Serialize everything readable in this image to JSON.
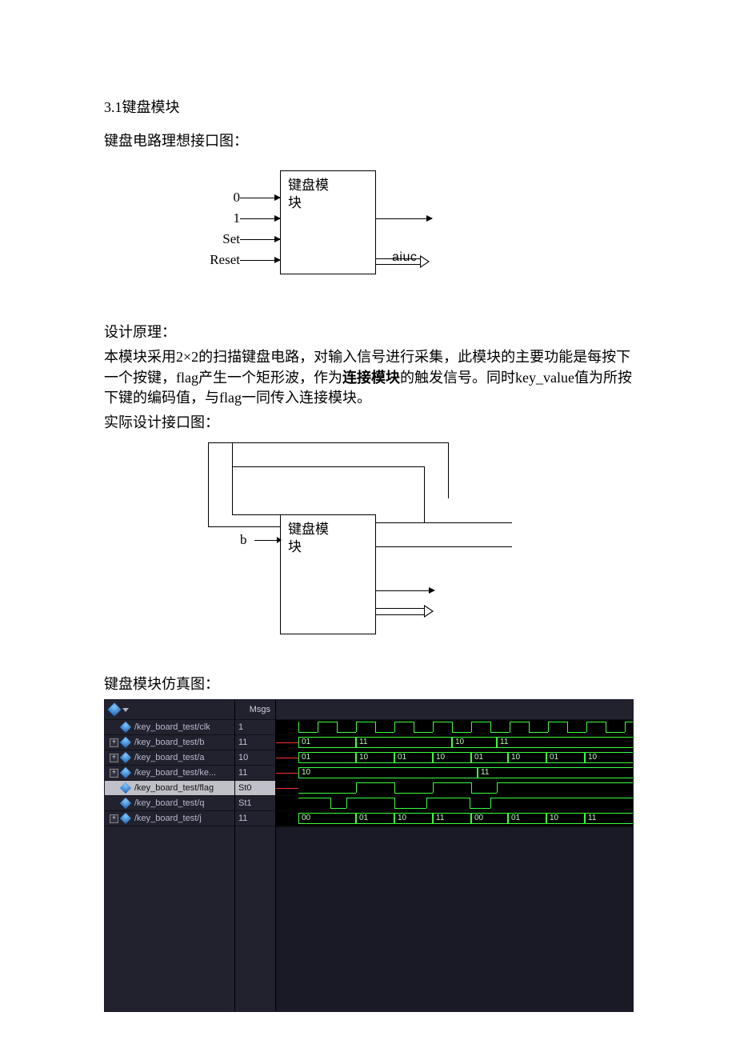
{
  "section_title": "3.1键盘模块",
  "para1": "键盘电路理想接口图：",
  "diagram1": {
    "block_label": "键盘模块",
    "inputs": [
      "0",
      "1",
      "Set",
      "Reset"
    ],
    "clipped_text": "aiuc"
  },
  "para2_title": "设计原理：",
  "para2_body": "本模块采用2×2的扫描键盘电路，对输入信号进行采集，此模块的主要功能是每按下一个按键，flag产生一个矩形波，作为连接模块的触发信号。同时key_value值为所按下键的编码值，与flag一同传入连接模块。",
  "para3": "实际设计接口图：",
  "diagram2": {
    "block_label": "键盘模块",
    "left_label": "b"
  },
  "wave_caption": "键盘模块仿真图：",
  "waveform": {
    "msgs_label": "Msgs",
    "icon_name": "modelsim-logo-icon",
    "signals": [
      {
        "name": "/key_board_test/clk",
        "value": "1",
        "expandable": false
      },
      {
        "name": "/key_board_test/b",
        "value": "11",
        "expandable": true
      },
      {
        "name": "/key_board_test/a",
        "value": "10",
        "expandable": true
      },
      {
        "name": "/key_board_test/ke...",
        "value": "11",
        "expandable": true
      },
      {
        "name": "/key_board_test/flag",
        "value": "St0",
        "expandable": false,
        "selected": true
      },
      {
        "name": "/key_board_test/q",
        "value": "St1",
        "expandable": false
      },
      {
        "name": "/key_board_test/j",
        "value": "11",
        "expandable": true
      }
    ],
    "lanes": {
      "clk": {
        "type": "clock"
      },
      "b": {
        "segments": [
          [
            "01",
            0,
            72
          ],
          [
            "11",
            72,
            192
          ],
          [
            "10",
            192,
            248
          ],
          [
            "11",
            248,
            450
          ]
        ]
      },
      "a": {
        "segments": [
          [
            "01",
            0,
            72
          ],
          [
            "10",
            72,
            120
          ],
          [
            "01",
            120,
            168
          ],
          [
            "10",
            168,
            216
          ],
          [
            "01",
            216,
            262
          ],
          [
            "10",
            262,
            310
          ],
          [
            "01",
            310,
            358
          ],
          [
            "10",
            358,
            450
          ]
        ]
      },
      "ke": {
        "segments": [
          [
            "10",
            0,
            224
          ],
          [
            "11",
            224,
            450
          ]
        ]
      },
      "flag": {
        "type": "pulse",
        "edges": [
          [
            0,
            0
          ],
          [
            72,
            1
          ],
          [
            120,
            0
          ],
          [
            168,
            1
          ],
          [
            216,
            0
          ],
          [
            248,
            1
          ],
          [
            450,
            1
          ]
        ]
      },
      "q": {
        "type": "literal",
        "edges": [
          [
            0,
            1
          ],
          [
            40,
            1
          ],
          [
            40,
            0
          ],
          [
            60,
            0
          ],
          [
            60,
            1
          ],
          [
            120,
            1
          ],
          [
            120,
            0
          ],
          [
            160,
            0
          ],
          [
            160,
            1
          ],
          [
            214,
            1
          ],
          [
            214,
            0
          ],
          [
            240,
            0
          ],
          [
            240,
            1
          ],
          [
            450,
            1
          ]
        ]
      },
      "j": {
        "segments": [
          [
            "00",
            0,
            72
          ],
          [
            "01",
            72,
            120
          ],
          [
            "10",
            120,
            168
          ],
          [
            "11",
            168,
            216
          ],
          [
            "00",
            216,
            262
          ],
          [
            "01",
            262,
            310
          ],
          [
            "10",
            310,
            358
          ],
          [
            "11",
            358,
            450
          ]
        ]
      }
    }
  }
}
